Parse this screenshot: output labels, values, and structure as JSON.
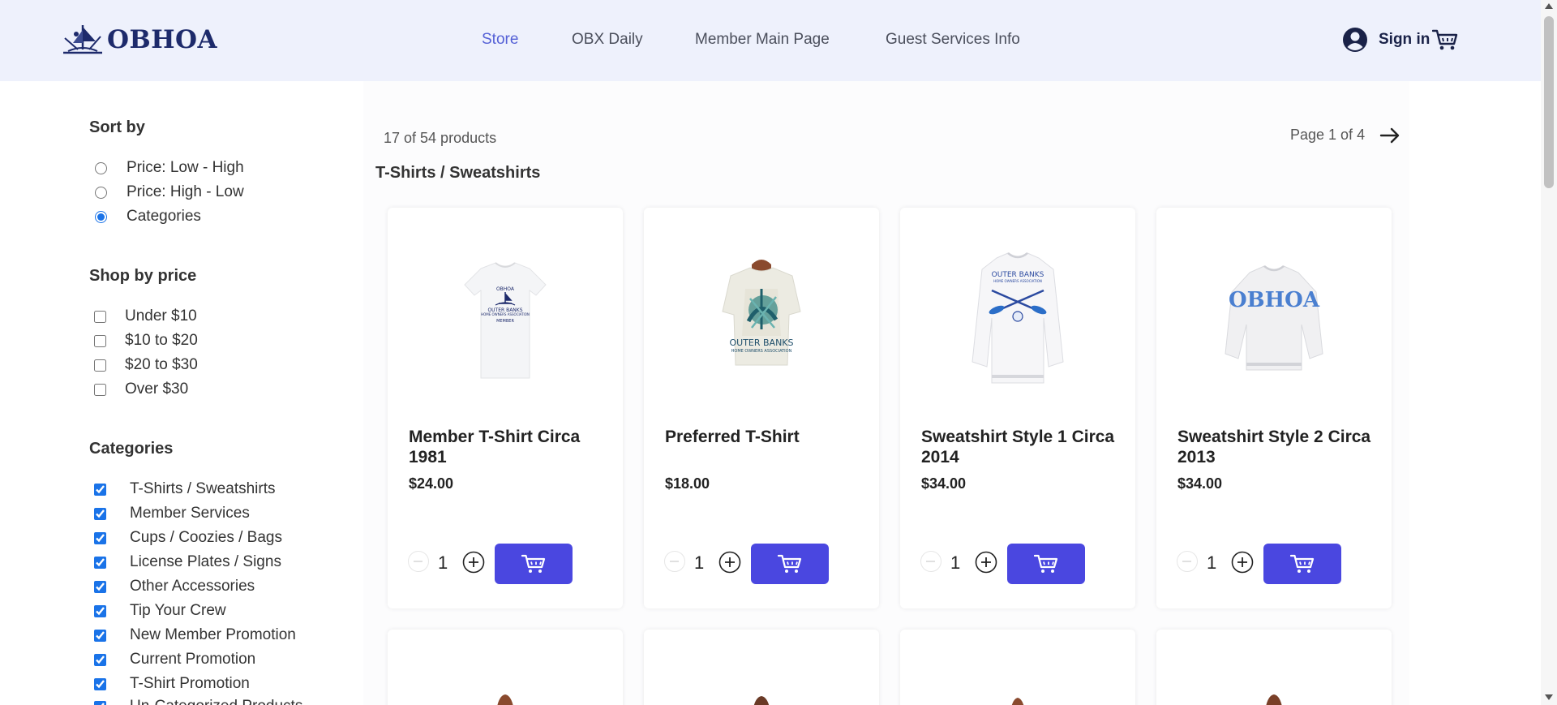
{
  "header": {
    "logo_text": "OBHOA",
    "nav": [
      {
        "label": "Store",
        "active": true
      },
      {
        "label": "OBX Daily",
        "active": false
      },
      {
        "label": "Member Main Page",
        "active": false
      },
      {
        "label": "Guest Services Info",
        "active": false
      }
    ],
    "sign_in_label": "Sign in"
  },
  "sidebar": {
    "sort": {
      "title": "Sort by",
      "options": [
        {
          "label": "Price: Low - High",
          "selected": false
        },
        {
          "label": "Price: High - Low",
          "selected": false
        },
        {
          "label": "Categories",
          "selected": true
        }
      ]
    },
    "price": {
      "title": "Shop by price",
      "options": [
        {
          "label": "Under $10",
          "checked": false
        },
        {
          "label": "$10 to $20",
          "checked": false
        },
        {
          "label": "$20 to $30",
          "checked": false
        },
        {
          "label": "Over $30",
          "checked": false
        }
      ]
    },
    "categories": {
      "title": "Categories",
      "options": [
        {
          "label": "T-Shirts / Sweatshirts",
          "checked": true
        },
        {
          "label": "Member Services",
          "checked": true
        },
        {
          "label": "Cups / Coozies / Bags",
          "checked": true
        },
        {
          "label": "License Plates / Signs",
          "checked": true
        },
        {
          "label": "Other Accessories",
          "checked": true
        },
        {
          "label": "Tip Your Crew",
          "checked": true
        },
        {
          "label": "New Member Promotion",
          "checked": true
        },
        {
          "label": "Current Promotion",
          "checked": true
        },
        {
          "label": "T-Shirt Promotion",
          "checked": true
        },
        {
          "label": "Un-Categorized Products",
          "checked": true
        }
      ]
    }
  },
  "main": {
    "product_count": "17 of 54 products",
    "page_label": "Page 1 of 4",
    "category_heading": "T-Shirts / Sweatshirts",
    "products": [
      {
        "name": "Member T-Shirt Circa 1981",
        "price": "$24.00",
        "qty": "1"
      },
      {
        "name": "Preferred T-Shirt",
        "price": "$18.00",
        "qty": "1"
      },
      {
        "name": "Sweatshirt Style 1 Circa 2014",
        "price": "$34.00",
        "qty": "1"
      },
      {
        "name": "Sweatshirt Style 2 Circa 2013",
        "price": "$34.00",
        "qty": "1"
      }
    ]
  },
  "colors": {
    "header_bg": "#eef1fc",
    "accent": "#4a47e0",
    "active_nav": "#5561d6"
  }
}
